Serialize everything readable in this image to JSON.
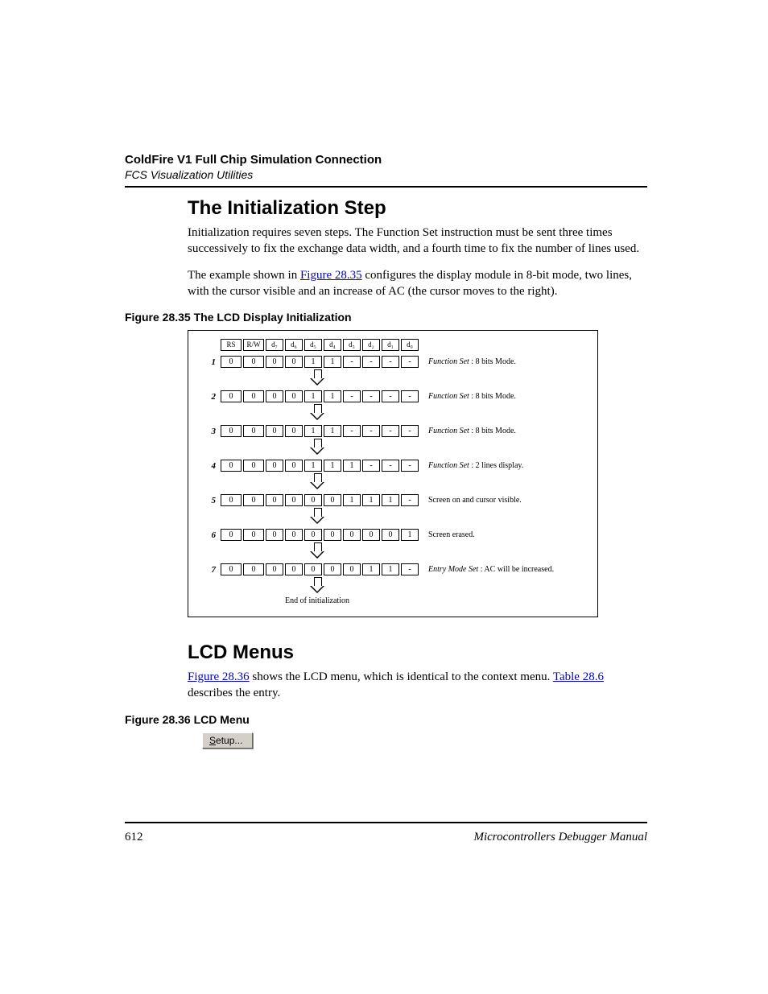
{
  "header": {
    "title": "ColdFire V1 Full Chip Simulation Connection",
    "subtitle": "FCS Visualization Utilities"
  },
  "section1": {
    "heading": "The Initialization Step",
    "p1": "Initialization requires seven steps. The Function Set instruction must be sent three times successively to fix the exchange data width, and a fourth time to fix the number of lines used.",
    "p2a": "The example shown in ",
    "p2_link": "Figure 28.35",
    "p2b": " configures the display module in 8-bit mode, two lines, with the cursor visible and an increase of AC (the cursor moves to the right)."
  },
  "fig35": {
    "caption": "Figure 28.35  The LCD Display Initialization",
    "headers": [
      "RS",
      "R/W",
      "d₇",
      "d₆",
      "d₅",
      "d₄",
      "d₃",
      "d₂",
      "d₁",
      "d₀"
    ],
    "rows": [
      {
        "n": "1",
        "v": [
          "0",
          "0",
          "0",
          "0",
          "1",
          "1",
          "-",
          "-",
          "-",
          "-"
        ],
        "i": "Function Set",
        "t": " : 8 bits Mode."
      },
      {
        "n": "2",
        "v": [
          "0",
          "0",
          "0",
          "0",
          "1",
          "1",
          "-",
          "-",
          "-",
          "-"
        ],
        "i": "Function Set",
        "t": " : 8 bits Mode."
      },
      {
        "n": "3",
        "v": [
          "0",
          "0",
          "0",
          "0",
          "1",
          "1",
          "-",
          "-",
          "-",
          "-"
        ],
        "i": "Function Set",
        "t": " : 8 bits Mode."
      },
      {
        "n": "4",
        "v": [
          "0",
          "0",
          "0",
          "0",
          "1",
          "1",
          "1",
          "-",
          "-",
          "-"
        ],
        "i": "Function Set",
        "t": " : 2 lines display."
      },
      {
        "n": "5",
        "v": [
          "0",
          "0",
          "0",
          "0",
          "0",
          "0",
          "1",
          "1",
          "1",
          "-"
        ],
        "i": "",
        "t": "Screen on and cursor visible."
      },
      {
        "n": "6",
        "v": [
          "0",
          "0",
          "0",
          "0",
          "0",
          "0",
          "0",
          "0",
          "0",
          "1"
        ],
        "i": "",
        "t": "Screen erased."
      },
      {
        "n": "7",
        "v": [
          "0",
          "0",
          "0",
          "0",
          "0",
          "0",
          "0",
          "1",
          "1",
          "-"
        ],
        "i": "Entry Mode Set",
        "t": " : AC will be increased."
      }
    ],
    "end": "End of initialization"
  },
  "section2": {
    "heading": "LCD Menus",
    "p1_link1": "Figure 28.36",
    "p1_mid": " shows the LCD menu, which is identical to the context menu. ",
    "p1_link2": "Table 28.6",
    "p1_end": " describes the entry."
  },
  "fig36": {
    "caption": "Figure 28.36  LCD Menu",
    "menu_u": "S",
    "menu_rest": "etup..."
  },
  "footer": {
    "page": "612",
    "title": "Microcontrollers Debugger Manual"
  }
}
